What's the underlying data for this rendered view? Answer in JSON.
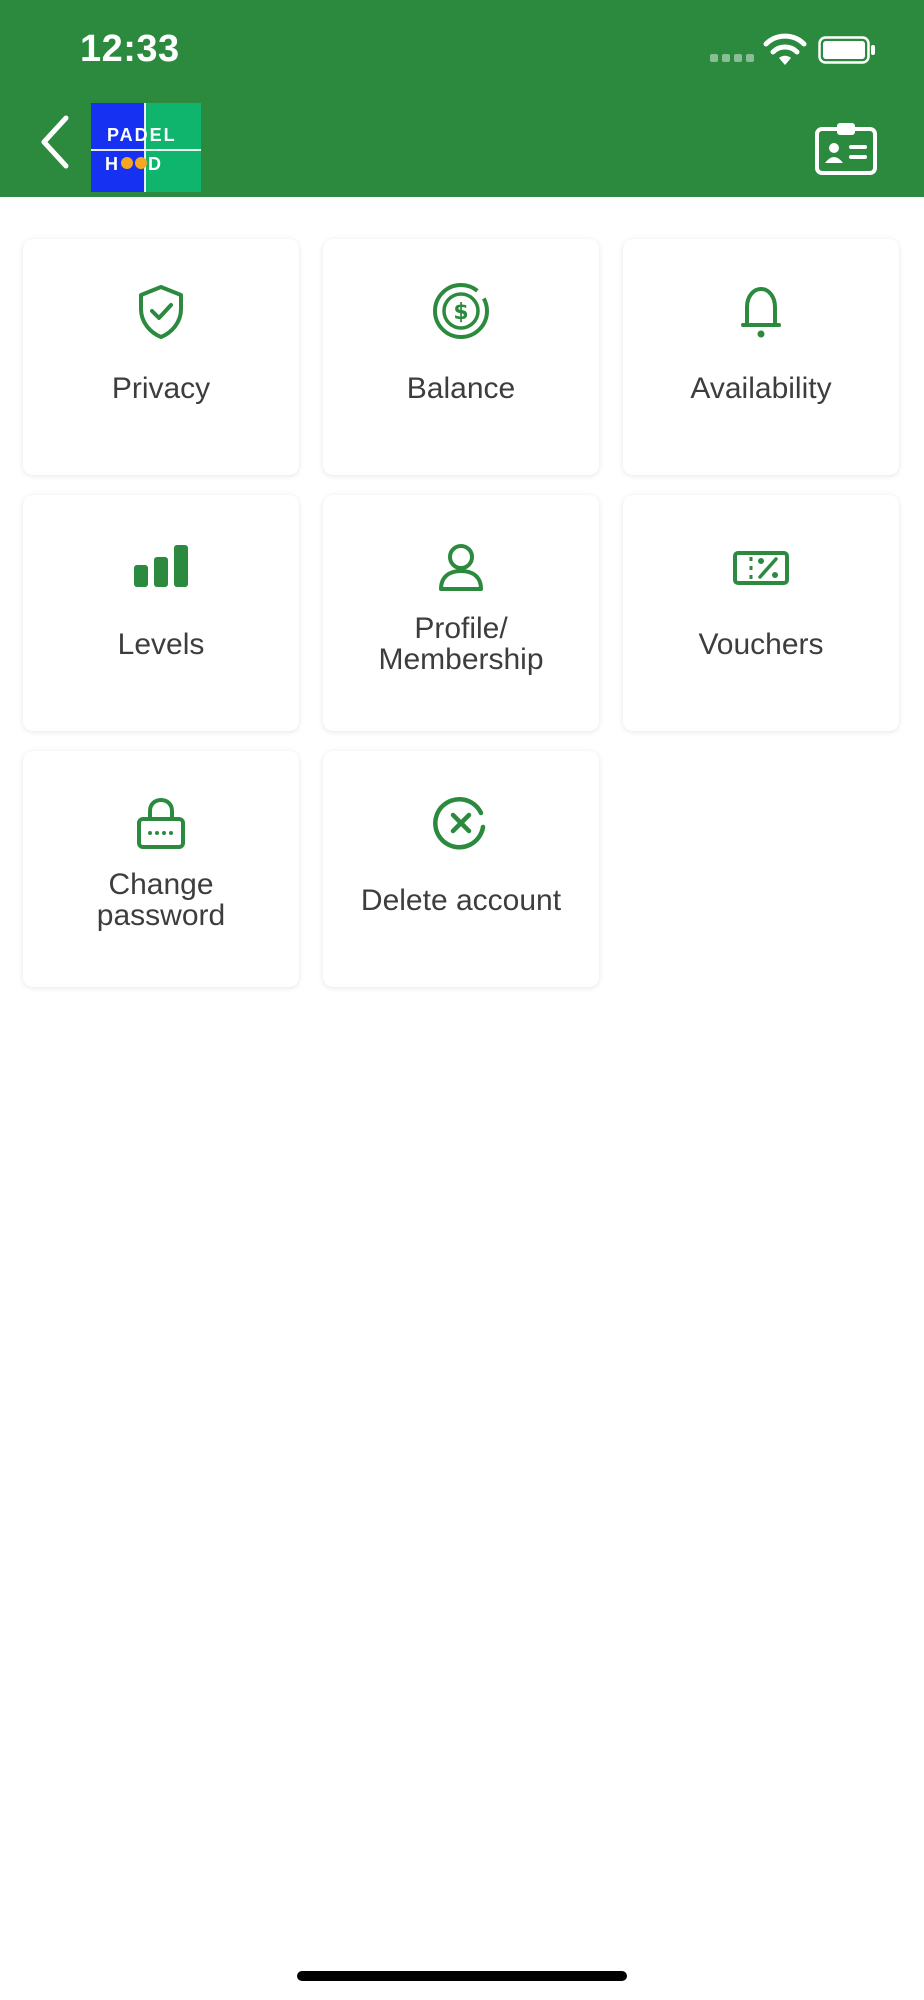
{
  "status_bar": {
    "time": "12:33",
    "signal_icon": "signal-dots-icon",
    "wifi_icon": "wifi-icon",
    "battery_icon": "battery-icon"
  },
  "header": {
    "background_color": "#2b8a3e",
    "back_icon": "chevron-left-icon",
    "logo": {
      "row1": "PADEL",
      "row2": "HOOD"
    },
    "right_icon": "contact-card-icon"
  },
  "menu": {
    "accent_color": "#2b8a3e",
    "items": [
      {
        "label": "Privacy",
        "icon": "shield-check-icon"
      },
      {
        "label": "Balance",
        "icon": "dollar-coin-icon"
      },
      {
        "label": "Availability",
        "icon": "bell-icon"
      },
      {
        "label": "Levels",
        "icon": "bar-chart-icon"
      },
      {
        "label_line1": "Profile/",
        "label_line2": "Membership",
        "icon": "user-icon"
      },
      {
        "label": "Vouchers",
        "icon": "voucher-percent-icon"
      },
      {
        "label_line1": "Change",
        "label_line2": "password",
        "icon": "lock-password-icon"
      },
      {
        "label": "Delete account",
        "icon": "close-circle-icon"
      }
    ]
  }
}
